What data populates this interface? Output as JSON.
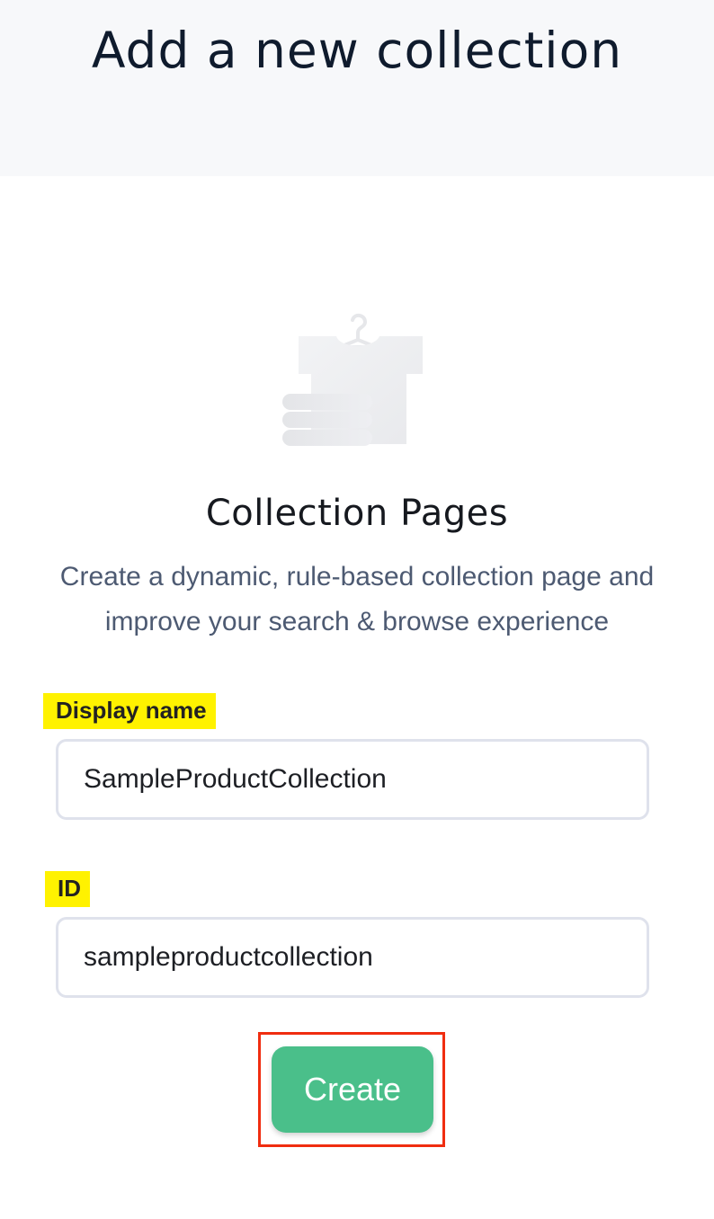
{
  "header": {
    "title": "Add a new collection"
  },
  "empty_state": {
    "icon": "clothing-hanger-icon",
    "title": "Collection Pages",
    "description": "Create a dynamic, rule-based collection page and improve your search & browse experience"
  },
  "form": {
    "display_name": {
      "label": "Display name",
      "value": "SampleProductCollection"
    },
    "id": {
      "label": "ID",
      "value": "sampleproductcollection"
    },
    "submit_label": "Create"
  },
  "colors": {
    "header_background": "#f7f8fa",
    "primary_button": "#4abf8a",
    "label_highlight": "#fff200",
    "annotation_box": "#f02d10"
  }
}
